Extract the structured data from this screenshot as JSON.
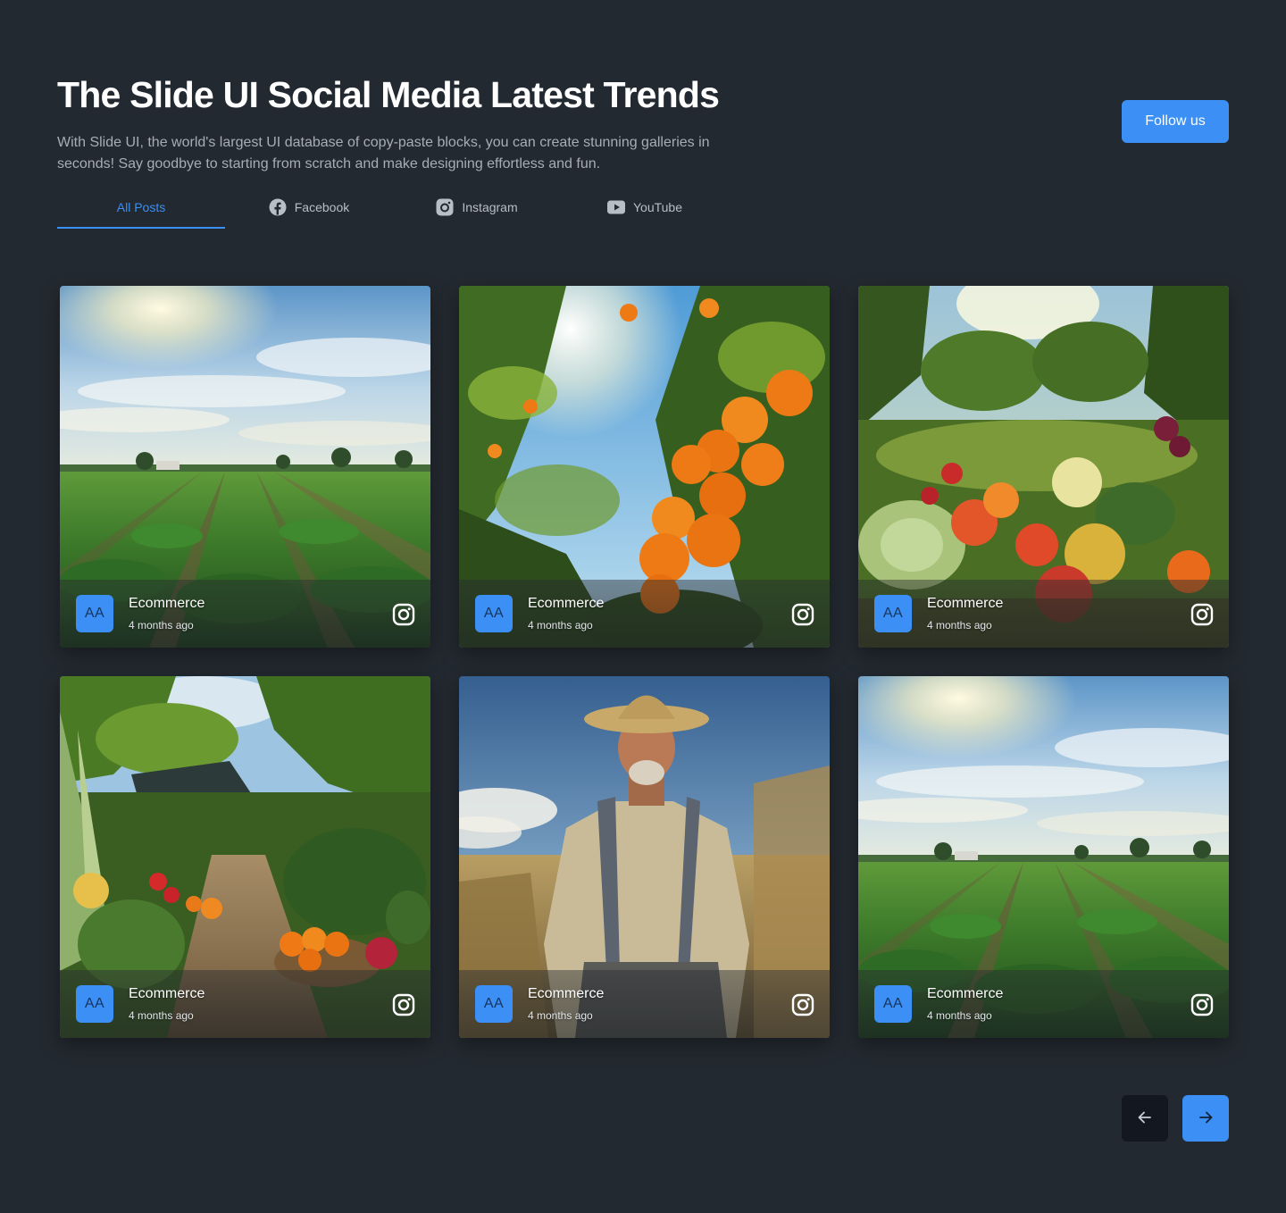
{
  "header": {
    "title": "The Slide UI Social Media Latest Trends",
    "subtitle": "With Slide UI, the world's largest UI database of copy-paste blocks, you can create stunning galleries in seconds! Say goodbye to starting from scratch and make designing effortless and fun.",
    "follow_label": "Follow us"
  },
  "tabs": [
    {
      "label": "All Posts",
      "icon": null,
      "active": true
    },
    {
      "label": "Facebook",
      "icon": "facebook-icon",
      "active": false
    },
    {
      "label": "Instagram",
      "icon": "instagram-icon",
      "active": false
    },
    {
      "label": "YouTube",
      "icon": "youtube-icon",
      "active": false
    }
  ],
  "posts": [
    {
      "avatar": "AA",
      "name": "Ecommerce",
      "time": "4 months ago",
      "platform": "instagram-icon",
      "image": "farm-field-rows"
    },
    {
      "avatar": "AA",
      "name": "Ecommerce",
      "time": "4 months ago",
      "platform": "instagram-icon",
      "image": "orange-tree"
    },
    {
      "avatar": "AA",
      "name": "Ecommerce",
      "time": "4 months ago",
      "platform": "instagram-icon",
      "image": "vegetable-harvest"
    },
    {
      "avatar": "AA",
      "name": "Ecommerce",
      "time": "4 months ago",
      "platform": "instagram-icon",
      "image": "garden-path"
    },
    {
      "avatar": "AA",
      "name": "Ecommerce",
      "time": "4 months ago",
      "platform": "instagram-icon",
      "image": "farmer-portrait"
    },
    {
      "avatar": "AA",
      "name": "Ecommerce",
      "time": "4 months ago",
      "platform": "instagram-icon",
      "image": "farm-field-rows"
    }
  ],
  "pagination": {
    "prev_icon": "arrow-left-icon",
    "next_icon": "arrow-right-icon"
  },
  "colors": {
    "background": "#232930",
    "accent": "#3b8ff5",
    "muted_text": "#a7adb6"
  }
}
